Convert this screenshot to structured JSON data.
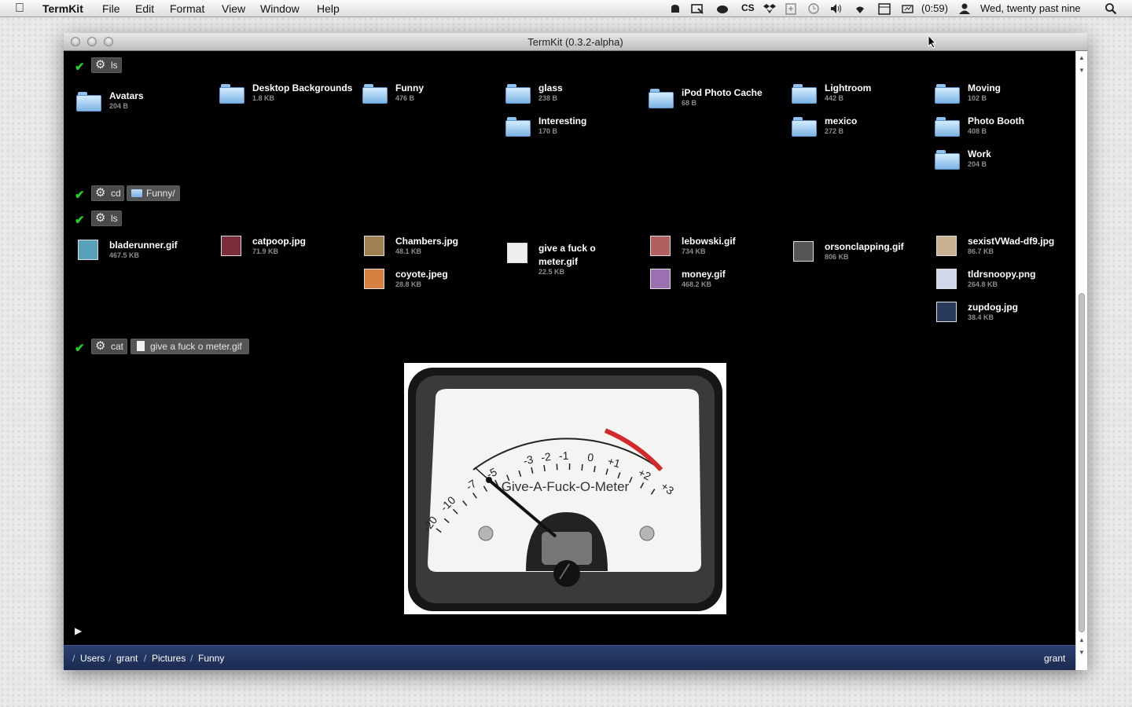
{
  "menubar": {
    "app_name": "TermKit",
    "menus": [
      "File",
      "Edit",
      "Format",
      "View",
      "Window",
      "Help"
    ],
    "battery": "(0:59)",
    "clock": "Wed, twenty past nine",
    "status_icons": [
      "growl-icon",
      "screen-icon",
      "bell-icon",
      "cs-icon",
      "dropbox-icon",
      "clipboard-icon",
      "time-machine-icon",
      "volume-icon",
      "wifi-icon",
      "calendar-icon",
      "battery-icon",
      "user-icon",
      "spotlight-icon"
    ],
    "cs_label": "CS"
  },
  "window": {
    "title": "TermKit (0.3.2-alpha)"
  },
  "commands": [
    {
      "check": "✔",
      "cmd": "ls"
    },
    {
      "check": "✔",
      "cmd": "cd",
      "arg": "Funny/"
    },
    {
      "check": "✔",
      "cmd": "ls"
    },
    {
      "check": "✔",
      "cmd": "cat",
      "arg": "give a fuck o meter.gif"
    }
  ],
  "listing1": [
    {
      "name": "Avatars",
      "size": "204 B"
    },
    {
      "name": "Desktop Backgrounds",
      "size": "1.8 KB"
    },
    {
      "name": "Funny",
      "size": "476 B"
    },
    {
      "name": "glass",
      "size": "238 B"
    },
    {
      "name": "Interesting",
      "size": "170 B"
    },
    {
      "name": "iPod Photo Cache",
      "size": "68 B"
    },
    {
      "name": "Lightroom",
      "size": "442 B"
    },
    {
      "name": "mexico",
      "size": "272 B"
    },
    {
      "name": "Moving",
      "size": "102 B"
    },
    {
      "name": "Photo Booth",
      "size": "408 B"
    },
    {
      "name": "Work",
      "size": "204 B"
    }
  ],
  "listing2": [
    {
      "name": "bladerunner.gif",
      "size": "467.5 KB",
      "color": "#5aa0b8"
    },
    {
      "name": "catpoop.jpg",
      "size": "71.9 KB",
      "color": "#7a2e3a"
    },
    {
      "name": "Chambers.jpg",
      "size": "48.1 KB",
      "color": "#a08050"
    },
    {
      "name": "coyote.jpeg",
      "size": "28.8 KB",
      "color": "#d88040"
    },
    {
      "name": "give a fuck o",
      "name2": "meter.gif",
      "size": "22.5 KB",
      "color": "#eeeeee"
    },
    {
      "name": "lebowski.gif",
      "size": "734 KB",
      "color": "#b06060"
    },
    {
      "name": "money.gif",
      "size": "468.2 KB",
      "color": "#9a70b0"
    },
    {
      "name": "orsonclapping.gif",
      "size": "806 KB",
      "color": "#555555"
    },
    {
      "name": "sexistVWad-df9.jpg",
      "size": "86.7 KB",
      "color": "#c8b090"
    },
    {
      "name": "tldrsnoopy.png",
      "size": "264.8 KB",
      "color": "#cfd8e8"
    },
    {
      "name": "zupdog.jpg",
      "size": "38.4 KB",
      "color": "#2a3a5a"
    }
  ],
  "meter": {
    "title": "Give-A-Fuck-O-Meter",
    "scale": [
      "-20",
      "-10",
      "-7",
      "-5",
      "-3",
      "-2",
      "-1",
      "0",
      "+1",
      "+2",
      "+3"
    ],
    "red_color": "#d22a2a"
  },
  "prompt": "▶",
  "path": [
    "/",
    "Users",
    "/",
    "grant",
    "/",
    "Pictures",
    "/",
    "Funny"
  ],
  "user": "grant"
}
